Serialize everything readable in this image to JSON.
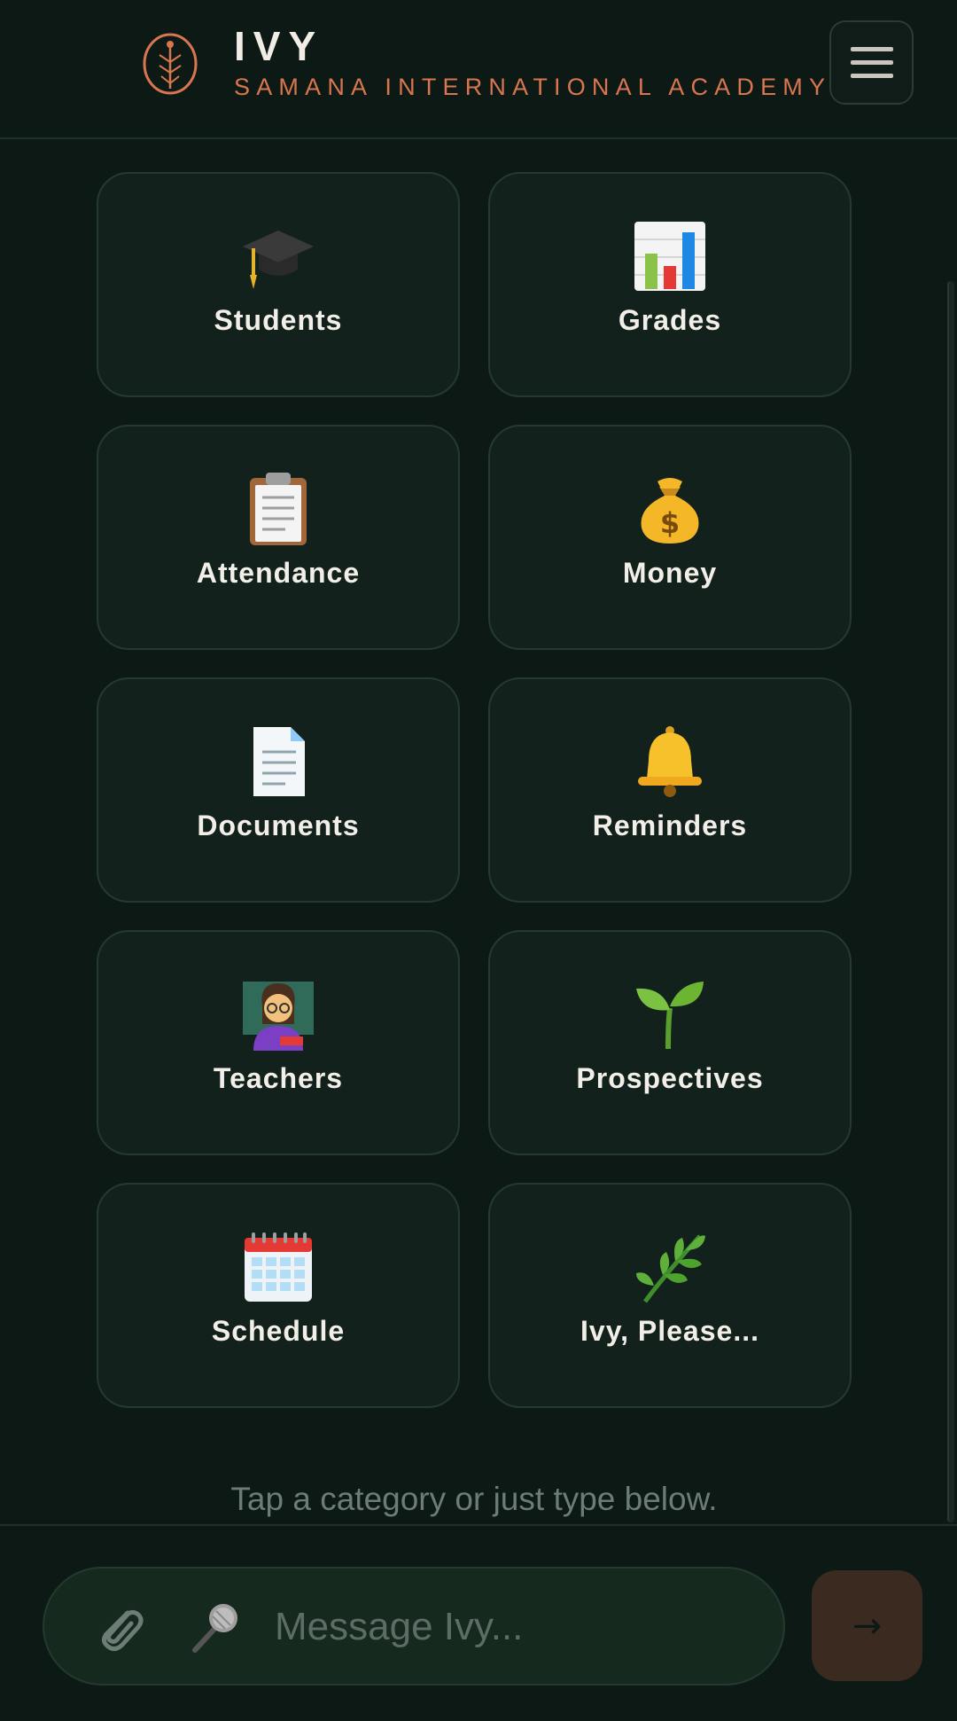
{
  "header": {
    "title": "IVY",
    "subtitle": "SAMANA INTERNATIONAL ACADEMY",
    "logo_icon": "leaf-seed-logo",
    "menu_icon": "hamburger-menu-icon",
    "accent_color": "#d9764f"
  },
  "categories": [
    {
      "label": "Students",
      "icon": "graduation-cap-icon"
    },
    {
      "label": "Grades",
      "icon": "bar-chart-icon"
    },
    {
      "label": "Attendance",
      "icon": "clipboard-icon"
    },
    {
      "label": "Money",
      "icon": "money-bag-icon"
    },
    {
      "label": "Documents",
      "icon": "document-icon"
    },
    {
      "label": "Reminders",
      "icon": "bell-icon"
    },
    {
      "label": "Teachers",
      "icon": "teacher-icon"
    },
    {
      "label": "Prospectives",
      "icon": "seedling-icon"
    },
    {
      "label": "Schedule",
      "icon": "calendar-icon"
    },
    {
      "label": "Ivy, Please...",
      "icon": "herb-icon"
    }
  ],
  "hint": "Tap a category or just type below.",
  "composer": {
    "placeholder": "Message Ivy...",
    "attach_icon": "paperclip-icon",
    "mic_icon": "microphone-icon",
    "send_symbol": "→"
  }
}
